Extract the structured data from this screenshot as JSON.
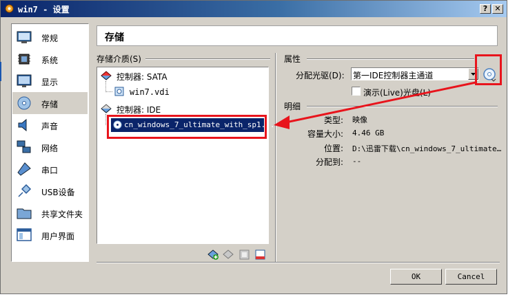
{
  "window": {
    "title": "win7 - 设置",
    "help_button": "?",
    "close_button": "✕"
  },
  "sidebar": {
    "items": [
      {
        "label": "常规",
        "icon": "general-icon"
      },
      {
        "label": "系统",
        "icon": "system-chip-icon"
      },
      {
        "label": "显示",
        "icon": "display-monitor-icon"
      },
      {
        "label": "存储",
        "icon": "storage-disk-icon",
        "selected": true
      },
      {
        "label": "声音",
        "icon": "audio-speaker-icon"
      },
      {
        "label": "网络",
        "icon": "network-icon"
      },
      {
        "label": "串口",
        "icon": "serial-port-icon"
      },
      {
        "label": "USB设备",
        "icon": "usb-icon"
      },
      {
        "label": "共享文件夹",
        "icon": "shared-folder-icon"
      },
      {
        "label": "用户界面",
        "icon": "user-interface-icon"
      }
    ]
  },
  "header": {
    "title": "存储"
  },
  "storage": {
    "group_label": "存储介质(S)",
    "controller_sata": "控制器: SATA",
    "disk_vdi": "win7.vdi",
    "controller_ide": "控制器: IDE",
    "optical_selected": "cn_windows_7_ultimate_with_sp1..."
  },
  "attributes": {
    "group_label": "属性",
    "drive_label": "分配光驱(D):",
    "drive_value": "第一IDE控制器主通道",
    "live_cd_label": "演示(Live)光盘(L)",
    "live_cd_checked": false
  },
  "details": {
    "group_label": "明细",
    "type_label": "类型:",
    "type_value": "映像",
    "size_label": "容量大小:",
    "size_value": "4.46  GB",
    "location_label": "位置:",
    "location_value": "D:\\迅雷下载\\cn_windows_7_ultimate…",
    "attached_label": "分配到:",
    "attached_value": "--"
  },
  "buttons": {
    "ok": "OK",
    "cancel": "Cancel"
  },
  "colors": {
    "highlight_red": "#e8141c",
    "selection_blue": "#0a246a",
    "dialog_bg": "#d4d0c8"
  }
}
